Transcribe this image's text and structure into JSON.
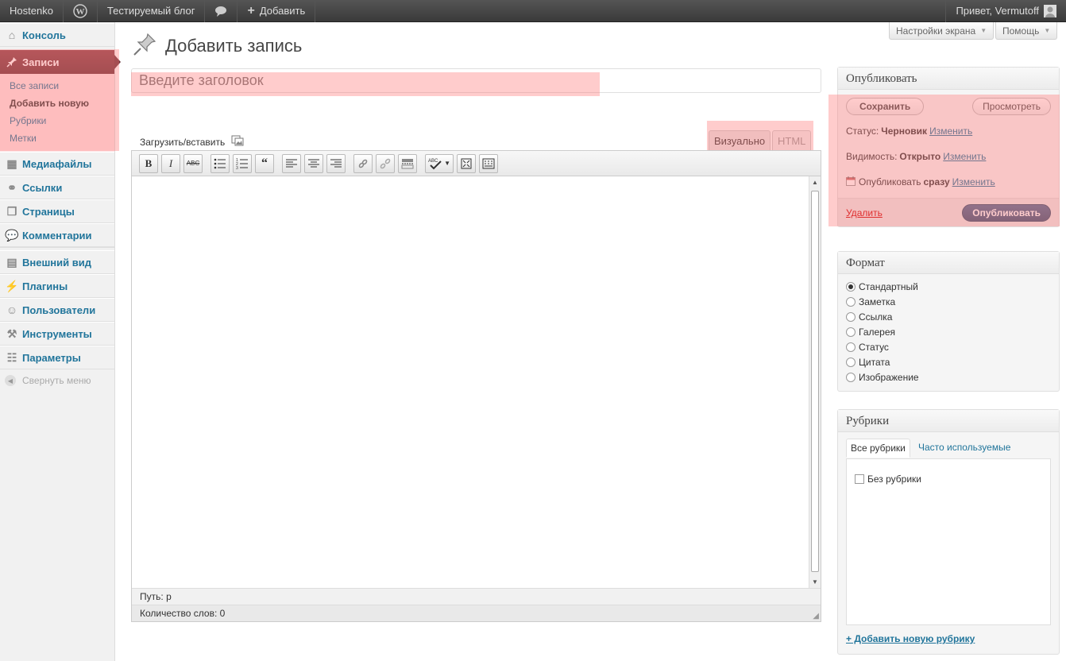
{
  "adminbar": {
    "site_name": "Hostenko",
    "blog_name": "Тестируемый блог",
    "add_new": "Добавить",
    "greeting": "Привет, Vermutoff"
  },
  "sidebar": {
    "items": [
      {
        "label": "Консоль",
        "icon": "home-icon"
      },
      {
        "label": "Записи",
        "icon": "pin-icon"
      },
      {
        "label": "Медиафайлы",
        "icon": "media-icon"
      },
      {
        "label": "Ссылки",
        "icon": "link-icon"
      },
      {
        "label": "Страницы",
        "icon": "pages-icon"
      },
      {
        "label": "Комментарии",
        "icon": "comment-icon"
      },
      {
        "label": "Внешний вид",
        "icon": "appearance-icon"
      },
      {
        "label": "Плагины",
        "icon": "plugin-icon"
      },
      {
        "label": "Пользователи",
        "icon": "users-icon"
      },
      {
        "label": "Инструменты",
        "icon": "tools-icon"
      },
      {
        "label": "Параметры",
        "icon": "settings-icon"
      }
    ],
    "submenu": [
      "Все записи",
      "Добавить новую",
      "Рубрики",
      "Метки"
    ],
    "collapse": "Свернуть меню"
  },
  "header": {
    "screen_options": "Настройки экрана",
    "help": "Помощь",
    "page_title": "Добавить запись"
  },
  "editor": {
    "title_placeholder": "Введите заголовок",
    "upload_label": "Загрузить/вставить",
    "tab_visual": "Визуально",
    "tab_html": "HTML",
    "path_label": "Путь:",
    "path_value": "p",
    "word_count": "Количество слов: 0"
  },
  "publish": {
    "title": "Опубликовать",
    "save": "Сохранить",
    "preview": "Просмотреть",
    "status_label": "Статус:",
    "status_value": "Черновик",
    "visibility_label": "Видимость:",
    "visibility_value": "Открыто",
    "schedule_label": "Опубликовать",
    "schedule_value": "сразу",
    "edit": "Изменить",
    "delete": "Удалить",
    "publish": "Опубликовать"
  },
  "format": {
    "title": "Формат",
    "options": [
      "Стандартный",
      "Заметка",
      "Ссылка",
      "Галерея",
      "Статус",
      "Цитата",
      "Изображение"
    ],
    "selected": 0
  },
  "categories": {
    "title": "Рубрики",
    "tab_all": "Все рубрики",
    "tab_popular": "Часто используемые",
    "items": [
      "Без рубрики"
    ],
    "add_new": "+ Добавить новую рубрику"
  },
  "colors": {
    "accent": "#21759b",
    "current_menu": "#6d343a",
    "highlight": "rgba(255,120,120,0.38)"
  }
}
